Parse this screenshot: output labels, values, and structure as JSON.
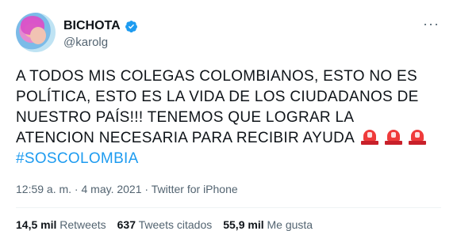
{
  "user": {
    "display_name": "BICHOTA",
    "handle": "@karolg"
  },
  "tweet": {
    "line1": "A TODOS MIS COLEGAS COLOMBIANOS, ESTO NO ES",
    "line2": "POLÍTICA, ESTO ES LA VIDA DE LOS CIUDADANOS DE",
    "line3": "NUESTRO PAÍS!!! TENEMOS QUE LOGRAR LA",
    "line4": "ATENCION NECESARIA PARA RECIBIR AYUDA",
    "emoji": [
      "police-car-light",
      "police-car-light",
      "police-car-light"
    ],
    "hashtag": "#SOSCOLOMBIA"
  },
  "meta": {
    "time": "12:59 a. m.",
    "separator": " · ",
    "date": "4 may. 2021",
    "source": "Twitter for iPhone"
  },
  "stats": {
    "retweets_count": "14,5 mil",
    "retweets_label": "Retweets",
    "quotes_count": "637",
    "quotes_label": "Tweets citados",
    "likes_count": "55,9 mil",
    "likes_label": "Me gusta"
  },
  "colors": {
    "verified": "#1d9bf0",
    "hashtag": "#1d9bf0",
    "muted": "#536471"
  }
}
